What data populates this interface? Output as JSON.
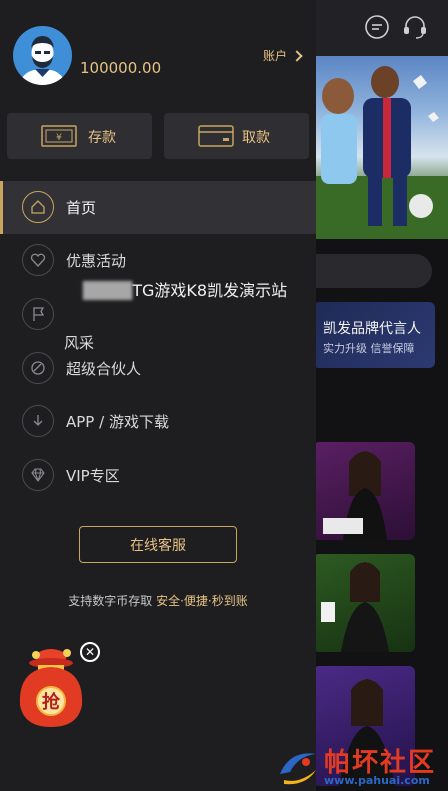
{
  "drawer": {
    "balance": "100000.00",
    "account_label": "账户",
    "deposit_label": "存款",
    "withdraw_label": "取款",
    "menu": [
      {
        "label": "首页",
        "icon": "home-icon",
        "active": true
      },
      {
        "label": "优惠活动",
        "icon": "heart-icon",
        "active": false
      },
      {
        "label": "风采",
        "icon": "flag-icon",
        "active": false
      },
      {
        "label": "超级合伙人",
        "icon": "partner-icon",
        "active": false
      },
      {
        "label": "APP / 游戏下载",
        "icon": "download-icon",
        "active": false
      },
      {
        "label": "VIP专区",
        "icon": "diamond-icon",
        "active": false
      }
    ],
    "service_label": "在线客服",
    "tagline_prefix": "支持数字币存取 ",
    "tagline_highlight": "安全·便捷·秒到账"
  },
  "site_name_blur": "████",
  "site_name": "TG游戏K8凯发演示站",
  "background": {
    "brand_title": "凯发品牌代言人",
    "brand_sub": "实力升级 信誉保障"
  },
  "watermark": {
    "name": "帕坏社区",
    "url": "www.pahuai.com"
  },
  "colors": {
    "accent_gold": "#e6c283",
    "drawer_bg": "#1e1e21",
    "active_bg": "#323236"
  }
}
